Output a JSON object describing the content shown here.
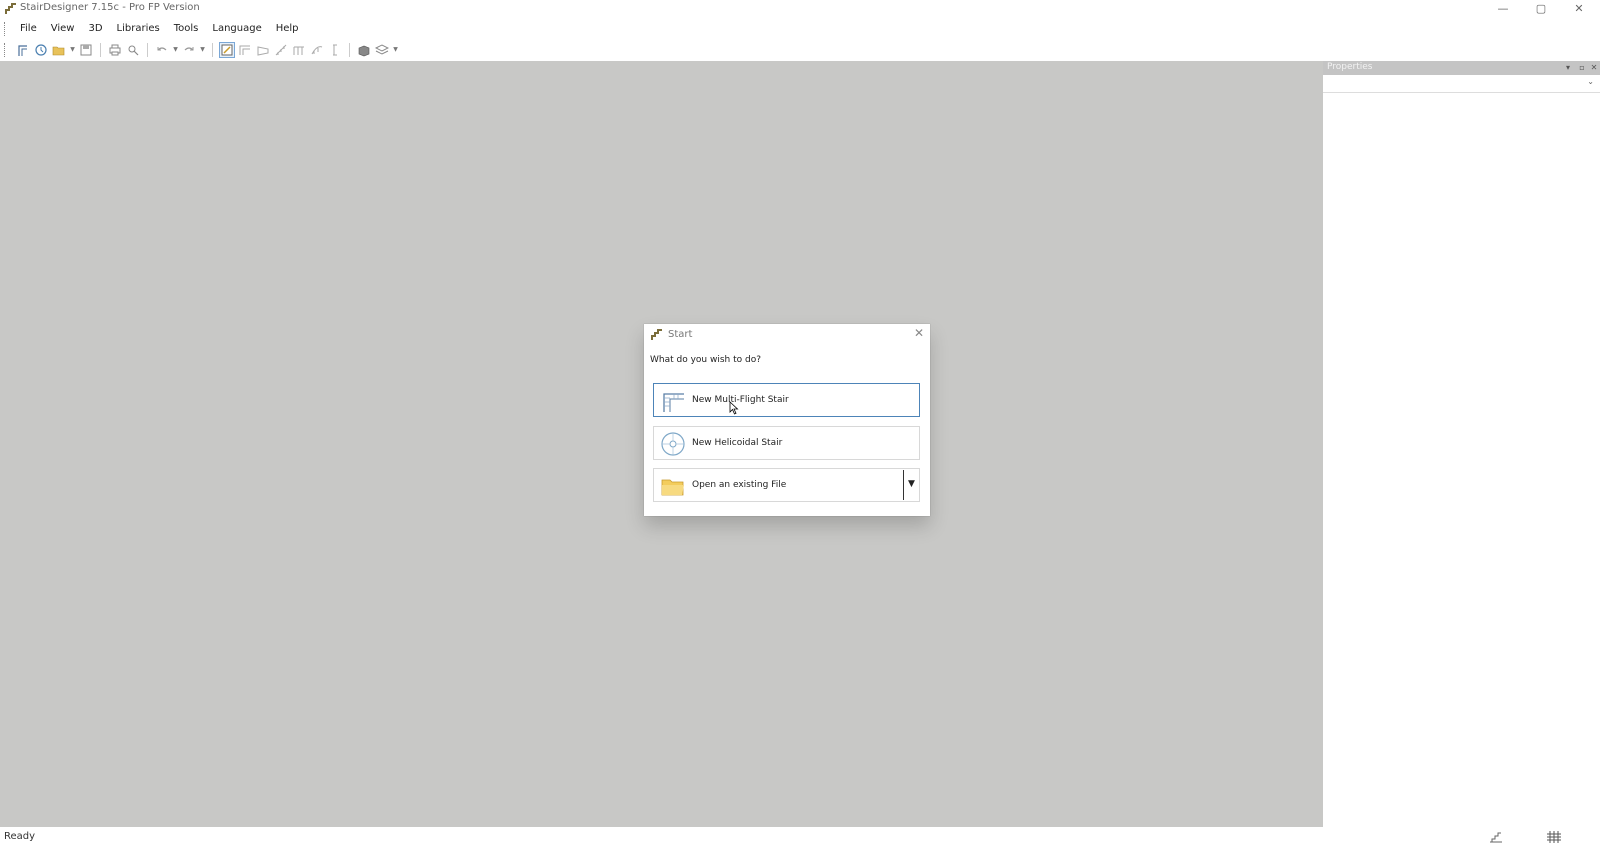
{
  "window": {
    "title": "StairDesigner 7.15c - Pro FP Version",
    "minimize_label": "—",
    "maximize_label": "▢",
    "close_label": "✕"
  },
  "menu": {
    "items": [
      "File",
      "View",
      "3D",
      "Libraries",
      "Tools",
      "Language",
      "Help"
    ]
  },
  "toolbar": {
    "buttons": [
      "new-stair-icon",
      "open-recent-icon",
      "open-folder-icon",
      "save-icon",
      "print-icon",
      "print-preview-icon",
      "undo-icon",
      "redo-icon",
      "wizard-icon",
      "straight-stair-icon",
      "winder-stair-icon",
      "spiral-stair-icon",
      "stringer-icon",
      "handrail-icon",
      "post-icon",
      "3d-view-icon",
      "layers-icon"
    ]
  },
  "properties": {
    "title": "Properties",
    "pin_label": "▾",
    "float_label": "▫",
    "close_label": "✕",
    "dropdown_arrow": "⌄"
  },
  "status": {
    "text": "Ready"
  },
  "dialog": {
    "title": "Start",
    "close_label": "✕",
    "question": "What do you wish to do?",
    "options": [
      {
        "label": "New Multi-Flight Stair",
        "icon": "multi-flight-stair-icon"
      },
      {
        "label": "New Helicoidal Stair",
        "icon": "helicoidal-stair-icon"
      },
      {
        "label": "Open an existing File",
        "icon": "folder-icon"
      }
    ],
    "dropdown_arrow": "▼"
  },
  "colors": {
    "workspace": "#c8c8c6",
    "selection_border": "#4d84b8",
    "properties_header": "#c4c4c4"
  }
}
